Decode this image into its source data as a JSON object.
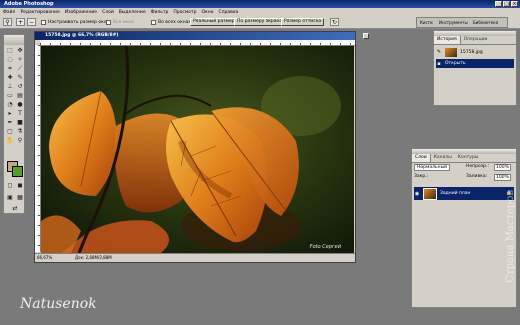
{
  "app": {
    "title": "Adobe Photoshop"
  },
  "menu": {
    "items": [
      "Файл",
      "Редактирование",
      "Изображение",
      "Слой",
      "Выделение",
      "Фильтр",
      "Просмотр",
      "Окно",
      "Справка"
    ]
  },
  "options": {
    "resize_windows": "Настраивать размер окон",
    "all_windows": "Все окна",
    "all_windows_zoom": "Во всех окнах",
    "actual_pixels": "Реальный размер",
    "fit_screen": "По размеру экрана",
    "print_size": "Размер оттиска"
  },
  "palette_well": {
    "tabs": [
      "Кисти",
      "Инструменты",
      "Библиотека"
    ]
  },
  "document": {
    "title": "15758.jpg @ 66,7% (RGB/8#)",
    "zoom": "66,67%",
    "doc_info": "Док: 2,88М/2,88М",
    "photo_credit": "Foto Сергей"
  },
  "history_panel": {
    "tabs": [
      "История",
      "Операции"
    ],
    "snapshot": "15758.jpg",
    "step": "Открыть"
  },
  "layers_panel": {
    "tabs": [
      "Слои",
      "Каналы",
      "Контуры"
    ],
    "blend": "Нормальный",
    "opacity_label": "Непрозр.:",
    "opacity": "100%",
    "lock_label": "Закр.:",
    "fill_label": "Заливка:",
    "fill": "100%",
    "layer_name": "Задний план"
  },
  "watermark": "Страна Мастеров",
  "signature": "Natusenok",
  "colors": {
    "foreground": "#c8a878",
    "background": "#58a018",
    "selection": "#0a246a"
  }
}
